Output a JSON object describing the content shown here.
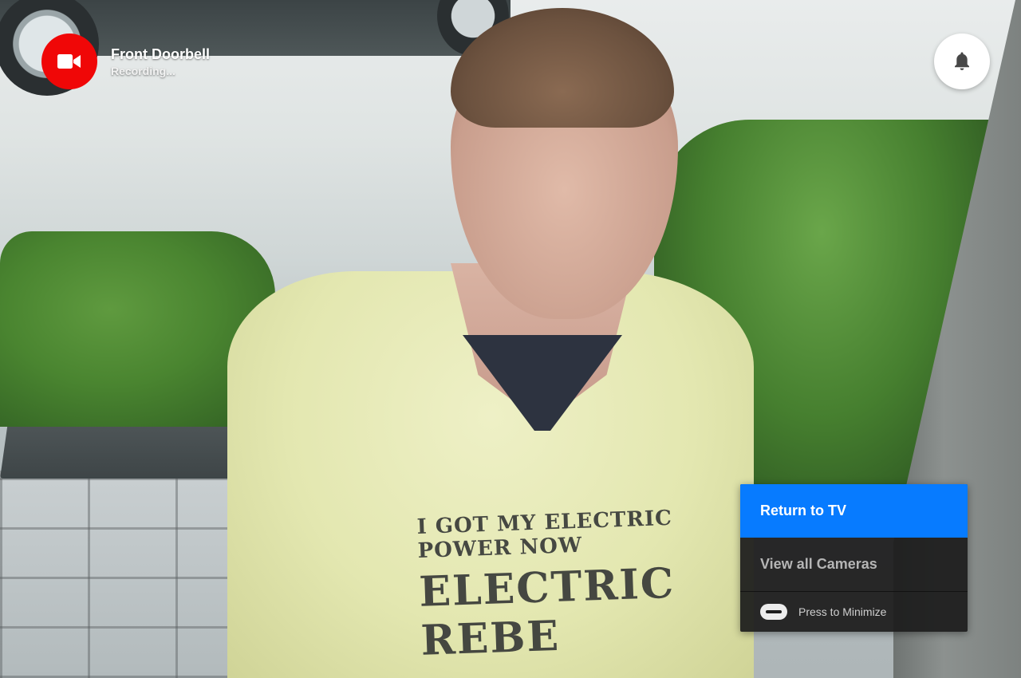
{
  "camera": {
    "title": "Front Doorbell",
    "status": "Recording...",
    "badge_color": "#f00707",
    "badge_icon": "video-camera-icon"
  },
  "notification": {
    "icon": "bell-icon"
  },
  "menu": {
    "primary_label": "Return to TV",
    "secondary_label": "View all Cameras",
    "hint_label": "Press to Minimize",
    "hint_icon": "minimize-button-icon",
    "accent_color": "#077bff"
  },
  "feed": {
    "shirt_line_1": "I GOT MY ELECTRIC POWER NOW",
    "shirt_line_2": "ELECTRIC REBE"
  }
}
